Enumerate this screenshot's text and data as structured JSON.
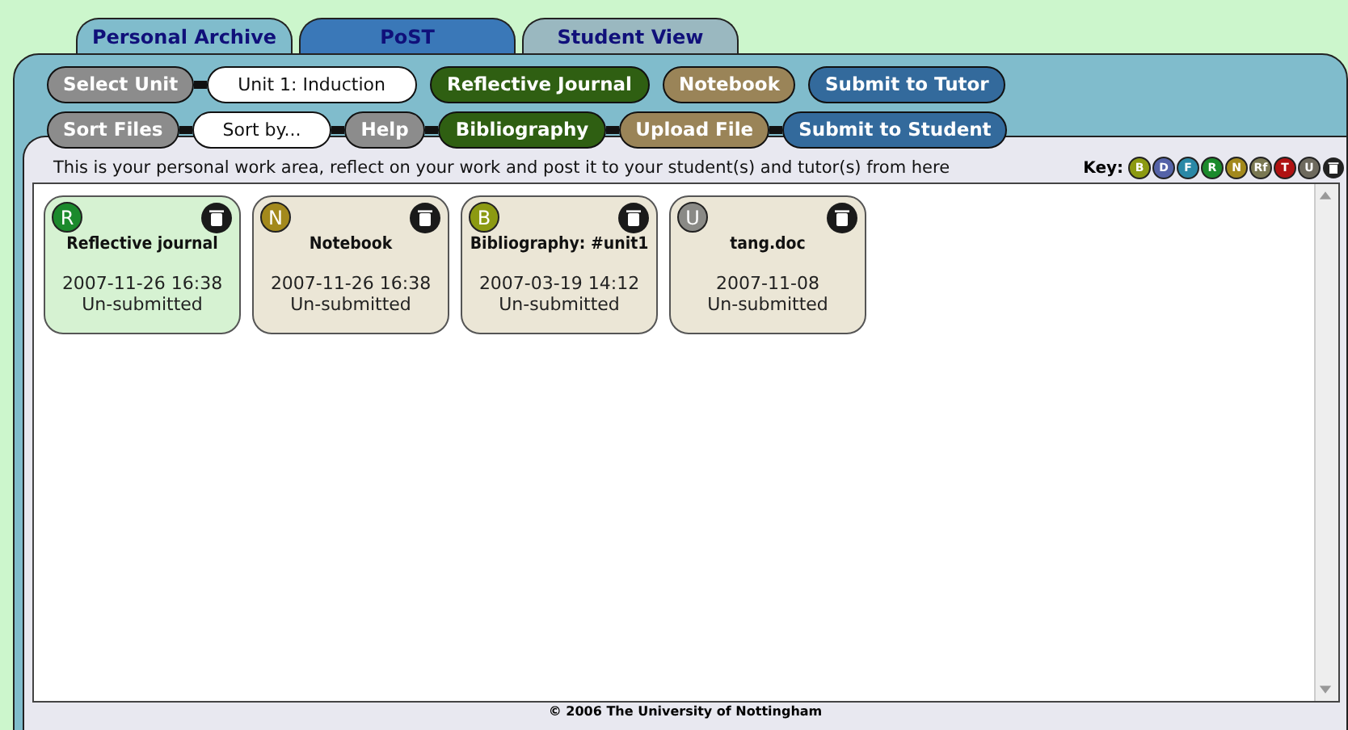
{
  "tabs": [
    {
      "label": "Personal Archive",
      "selected": true
    },
    {
      "label": "PoST",
      "selected": false
    },
    {
      "label": "Student View",
      "selected": false
    }
  ],
  "toolbar_rows": [
    [
      {
        "kind": "grey",
        "label": "Select Unit"
      },
      {
        "kind": "field",
        "label": "Unit 1: Induction"
      },
      {
        "kind": "green",
        "label": "Reflective Journal"
      },
      {
        "kind": "brown",
        "label": "Notebook"
      },
      {
        "kind": "blue",
        "label": "Submit to Tutor"
      }
    ],
    [
      {
        "kind": "grey",
        "label": "Sort Files"
      },
      {
        "kind": "field",
        "label": "Sort by..."
      },
      {
        "kind": "grey",
        "label": "Help"
      },
      {
        "kind": "green",
        "label": "Bibliography"
      },
      {
        "kind": "brown",
        "label": "Upload File"
      },
      {
        "kind": "blue",
        "label": "Submit to Student"
      }
    ]
  ],
  "description": "This is your personal work area, reflect on your work and post it to your student(s) and tutor(s) from here",
  "key": {
    "label": "Key:",
    "items": [
      {
        "kind": "letter",
        "letter": "B",
        "color": "#8c9a12"
      },
      {
        "kind": "letter",
        "letter": "D",
        "color": "#5563a8"
      },
      {
        "kind": "letter",
        "letter": "F",
        "color": "#2a88a6"
      },
      {
        "kind": "letter",
        "letter": "R",
        "color": "#1b8a2c"
      },
      {
        "kind": "letter",
        "letter": "N",
        "color": "#a3891c"
      },
      {
        "kind": "letter",
        "letter": "Rf",
        "color": "#7a7852"
      },
      {
        "kind": "letter",
        "letter": "T",
        "color": "#b01212"
      },
      {
        "kind": "letter",
        "letter": "U",
        "color": "#6e6a5e"
      },
      {
        "kind": "trash",
        "color": "#222222"
      }
    ]
  },
  "files": [
    {
      "letter": "R",
      "color": "#1b8a2c",
      "title": "Reflective journal",
      "date": "2007-11-26 16:38",
      "status": "Un-submitted",
      "selected": true
    },
    {
      "letter": "N",
      "color": "#a3891c",
      "title": "Notebook",
      "date": "2007-11-26 16:38",
      "status": "Un-submitted",
      "selected": false
    },
    {
      "letter": "B",
      "color": "#8c9a12",
      "title": "Bibliography: #unit1",
      "date": "2007-03-19 14:12",
      "status": "Un-submitted",
      "selected": false
    },
    {
      "letter": "U",
      "color": "#8a8a86",
      "title": "tang.doc",
      "date": "2007-11-08",
      "status": "Un-submitted",
      "selected": false
    }
  ],
  "footer": "© 2006 The University of Nottingham"
}
